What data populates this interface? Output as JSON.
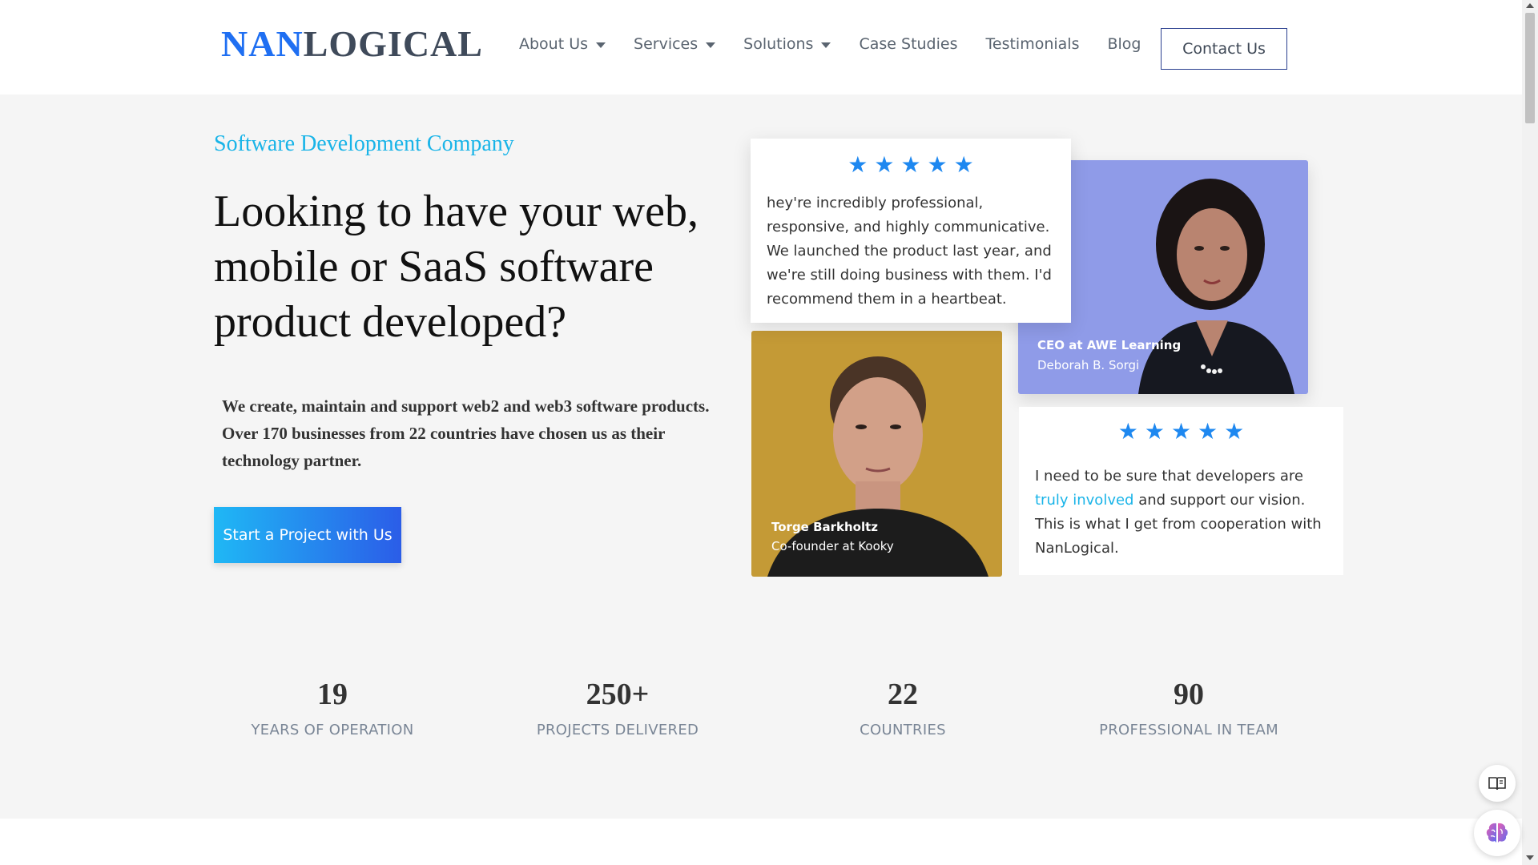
{
  "header": {
    "logo_accent": "NAN",
    "logo_rest": "LOGICAL",
    "nav": [
      {
        "label": "About Us"
      },
      {
        "label": "Services"
      },
      {
        "label": "Solutions"
      },
      {
        "label": "Case Studies"
      },
      {
        "label": "Testimonials"
      },
      {
        "label": "Blog"
      }
    ],
    "contact_label": "Contact Us"
  },
  "hero": {
    "eyebrow": "Software Development Company",
    "title": "Looking to have your web, mobile or SaaS software product developed?",
    "description": "We create, maintain and support web2 and web3 software products. Over 170 businesses from 22 countries have chosen us as their technology partner.",
    "cta_label": "Start a Project with Us"
  },
  "testimonials": {
    "first": {
      "rating": 5,
      "quote": "hey're incredibly professional, responsive, and highly communicative. We launched the product last year, and we're still doing business with them. I'd recommend them in a heartbeat.",
      "role": "CEO at AWE Learning",
      "name": "Deborah B. Sorgi"
    },
    "second": {
      "rating": 5,
      "quote_before": "I need to be sure that developers are ",
      "quote_highlight": "truly involved",
      "quote_after": " and support our vision. This is what I get from cooperation with NanLogical.",
      "name": "Torge Barkholtz",
      "role": "Co-founder at Kooky"
    }
  },
  "stats": [
    {
      "value": "19",
      "label": "YEARS OF OPERATION"
    },
    {
      "value": "250+",
      "label": "PROJECTS DELIVERED"
    },
    {
      "value": "22",
      "label": "COUNTRIES"
    },
    {
      "value": "90",
      "label": "PROFESSIONAL IN TEAM"
    }
  ],
  "colors": {
    "accent_blue": "#1f6ff2",
    "cyan": "#19b4e8",
    "star_blue": "#1e88f0",
    "woman_bg": "#8f9be8",
    "man_bg": "#c49a36"
  },
  "icons": {
    "reader": "reader-mode-icon",
    "assistant": "brain-icon"
  }
}
